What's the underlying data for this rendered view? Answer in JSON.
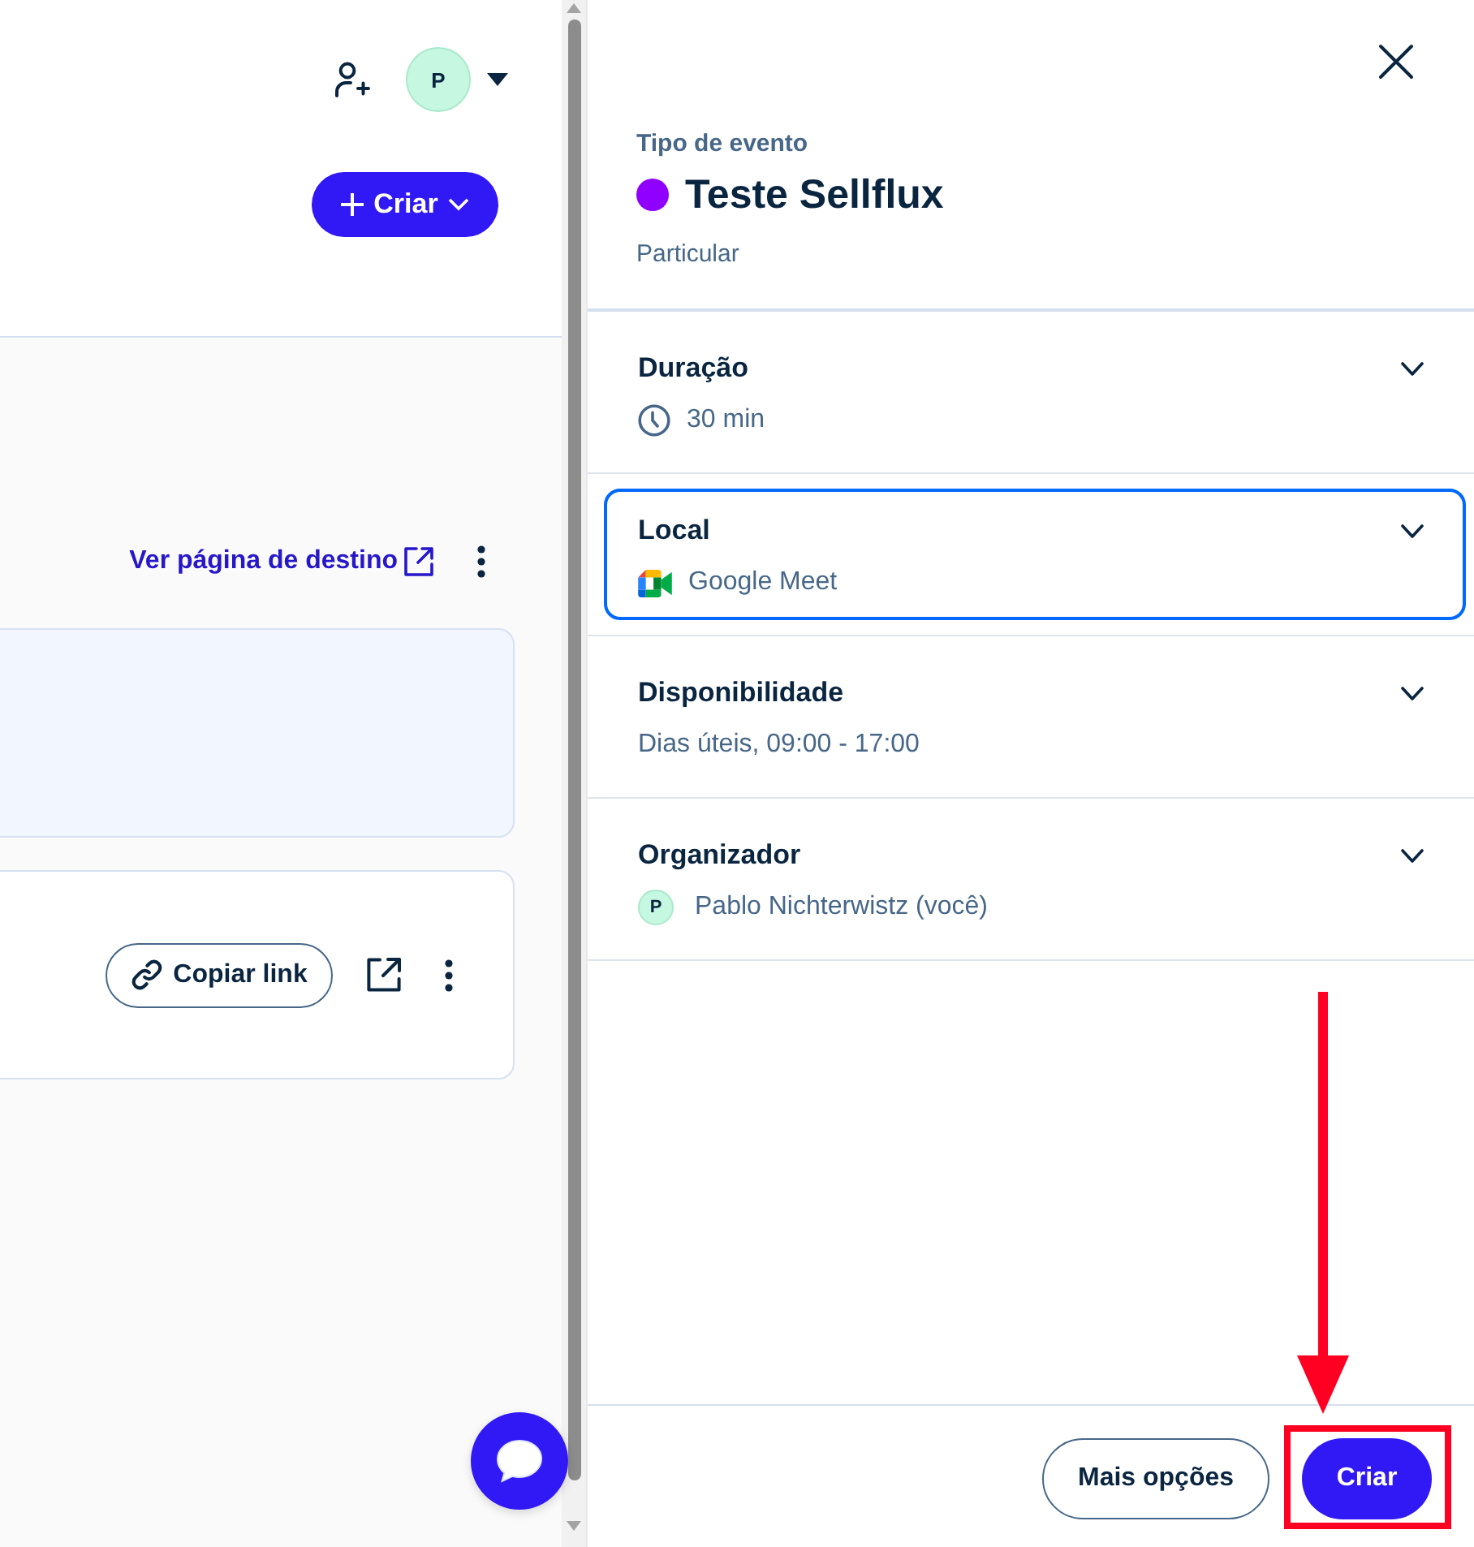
{
  "left_pane": {
    "header": {
      "avatar_initial": "P",
      "create_button": "Criar"
    },
    "landing_link": "Ver página de destino",
    "cards": [
      {
        "kind": "empty",
        "highlighted": true
      },
      {
        "kind": "link",
        "highlighted": false,
        "copy_button": "Copiar link"
      }
    ]
  },
  "event": {
    "eyebrow": "Tipo de evento",
    "color": "#8f00ff",
    "title": "Teste Sellflux",
    "subtitle": "Particular",
    "sections": [
      {
        "kind": "duration",
        "title": "Duração",
        "value": "30 min",
        "selected": false,
        "expanded": false
      },
      {
        "kind": "location",
        "title": "Local",
        "value": "Google Meet",
        "selected": true,
        "expanded": false
      },
      {
        "kind": "schedule",
        "title": "Disponibilidade",
        "value": "Dias úteis, 09:00 - 17:00",
        "selected": false,
        "expanded": false
      },
      {
        "kind": "organizer",
        "title": "Organizador",
        "initial": "P",
        "value": "Pablo Nichterwistz (você)",
        "selected": false,
        "expanded": false
      }
    ],
    "footer": {
      "secondary_button": "Mais opções",
      "primary_button": "Criar"
    }
  },
  "annotations": {
    "arrow": true,
    "highlight_frame": true
  }
}
